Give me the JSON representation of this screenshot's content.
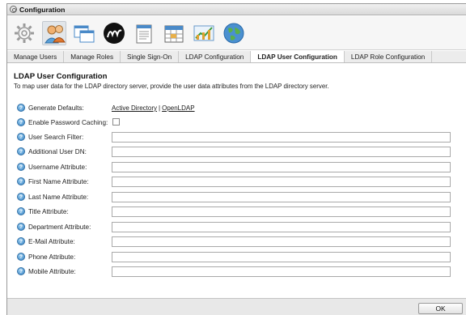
{
  "window": {
    "title": "Configuration"
  },
  "toolbar": {
    "icons": [
      "settings-gear-icon",
      "users-icon",
      "windows-icon",
      "brand-logo-icon",
      "notepad-icon",
      "calendar-icon",
      "chart-icon",
      "globe-icon"
    ]
  },
  "tabs": [
    {
      "label": "Manage Users"
    },
    {
      "label": "Manage Roles"
    },
    {
      "label": "Single Sign-On"
    },
    {
      "label": "LDAP Configuration"
    },
    {
      "label": "LDAP User Configuration"
    },
    {
      "label": "LDAP Role Configuration"
    }
  ],
  "section": {
    "title": "LDAP User Configuration",
    "description": "To map user data for the LDAP directory server, provide the user data attributes from the LDAP directory server."
  },
  "form": {
    "generate_defaults": {
      "label": "Generate Defaults:",
      "link1": "Active Directory",
      "separator": "|",
      "link2": "OpenLDAP"
    },
    "password_caching": {
      "label": "Enable Password Caching:",
      "checked": false
    },
    "fields": [
      {
        "label": "User Search Filter:",
        "value": ""
      },
      {
        "label": "Additional User DN:",
        "value": ""
      },
      {
        "label": "Username Attribute:",
        "value": ""
      },
      {
        "label": "First Name Attribute:",
        "value": ""
      },
      {
        "label": "Last Name Attribute:",
        "value": ""
      },
      {
        "label": "Title Attribute:",
        "value": ""
      },
      {
        "label": "Department Attribute:",
        "value": ""
      },
      {
        "label": "E-Mail Attribute:",
        "value": ""
      },
      {
        "label": "Phone Attribute:",
        "value": ""
      },
      {
        "label": "Mobile Attribute:",
        "value": ""
      }
    ],
    "help_glyph": "?"
  },
  "footer": {
    "ok_label": "OK"
  },
  "colors": {
    "help_blue": "#3a86c6",
    "active_tab_bg": "#ffffff",
    "footer_bg": "#e8e8e8"
  }
}
